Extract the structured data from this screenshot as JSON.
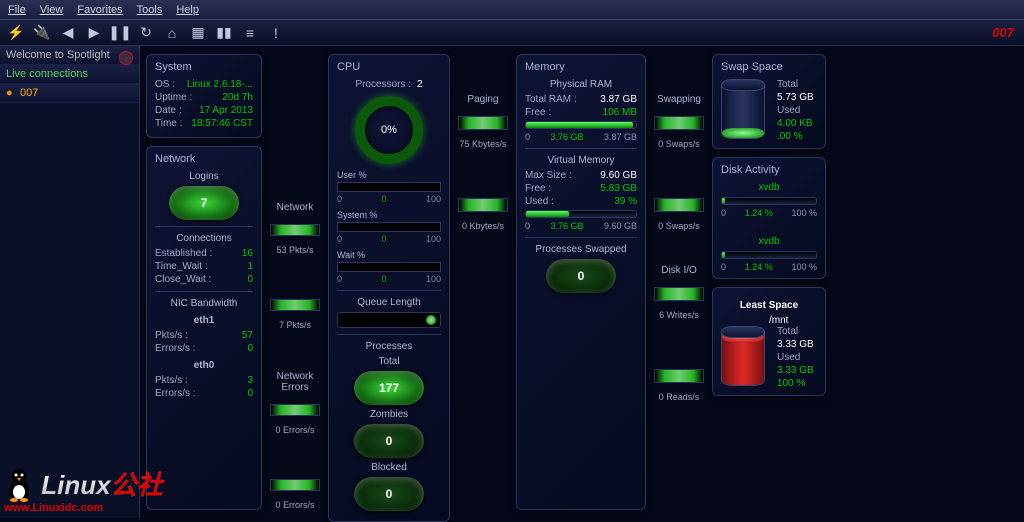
{
  "menu": {
    "file": "File",
    "view": "View",
    "favorites": "Favorites",
    "tools": "Tools",
    "help": "Help"
  },
  "host_id": "007",
  "sidebar": {
    "welcome": "Welcome to Spotlight",
    "live": "Live connections",
    "host": "007"
  },
  "system": {
    "title": "System",
    "os_k": "OS :",
    "os_v": "Linux  2.6.18-...",
    "up_k": "Uptime :",
    "up_v": "20d 7h",
    "date_k": "Date :",
    "date_v": "17 Apr 2013",
    "time_k": "Time :",
    "time_v": "18:57:46 CST"
  },
  "network": {
    "title": "Network",
    "logins_label": "Logins",
    "logins": "7",
    "conns_label": "Connections",
    "est_k": "Established :",
    "est_v": "16",
    "tw_k": "Time_Wait :",
    "tw_v": "1",
    "cw_k": "Close_Wait :",
    "cw_v": "0",
    "nicbw": "NIC Bandwidth",
    "nic1": "eth1",
    "nic1_pk": "Pkts/s :",
    "nic1_pv": "57",
    "nic1_ek": "Errors/s :",
    "nic1_ev": "0",
    "nic0": "eth0",
    "nic0_pk": "Pkts/s :",
    "nic0_pv": "3",
    "nic0_ek": "Errors/s :",
    "nic0_ev": "0"
  },
  "netflow": {
    "label": "Network",
    "v1": "53 Pkts/s",
    "v2": "7 Pkts/s",
    "errlabel": "Network Errors",
    "e1": "0 Errors/s",
    "e2": "0 Errors/s"
  },
  "cpu": {
    "title": "CPU",
    "proc_k": "Processors :",
    "proc_v": "2",
    "pct": "0%",
    "user": "User %",
    "system": "System %",
    "wait": "Wait %",
    "s0": "0",
    "sg": "0",
    "s100": "100",
    "qlen": "Queue Length",
    "processes": "Processes",
    "total_l": "Total",
    "total": "177",
    "zombies_l": "Zombies",
    "zombies": "0",
    "blocked_l": "Blocked",
    "blocked": "0"
  },
  "paging": {
    "label": "Paging",
    "v1": "75 Kbytes/s",
    "v2": "0 Kbytes/s"
  },
  "memory": {
    "title": "Memory",
    "phys": "Physical RAM",
    "tram_k": "Total RAM :",
    "tram_v": "3.87 GB",
    "free_k": "Free :",
    "free_v": "106 MB",
    "bar_lo": "0",
    "bar_mid": "3.76 GB",
    "bar_hi": "3.87 GB",
    "virt": "Virtual Memory",
    "max_k": "Max Size :",
    "max_v": "9.60 GB",
    "vfree_k": "Free :",
    "vfree_v": "5.83 GB",
    "used_k": "Used :",
    "used_v": "39 %",
    "vbar_lo": "0",
    "vbar_mid": "3.76 GB",
    "vbar_hi": "9.60 GB",
    "pswap_l": "Processes Swapped",
    "pswap": "0"
  },
  "swapping": {
    "label": "Swapping",
    "v1": "0 Swaps/s",
    "v2": "0 Swaps/s",
    "io_label": "Disk I/O",
    "io1": "6 Writes/s",
    "io2": "0 Reads/s"
  },
  "swap": {
    "title": "Swap Space",
    "total_l": "Total",
    "total": "5.73 GB",
    "used_l": "Used",
    "used": "4.00 KB",
    "pct": ".00 %"
  },
  "disk": {
    "title": "Disk Activity",
    "d1": "xvdb",
    "d1_lo": "0",
    "d1_mid": "1.24 %",
    "d1_hi": "100 %",
    "d2": "xvdb",
    "d2_lo": "0",
    "d2_mid": "1.24 %",
    "d2_hi": "100 %"
  },
  "least": {
    "title": "Least Space",
    "mount": "/mnt",
    "total_l": "Total",
    "total": "3.33 GB",
    "used_l": "Used",
    "used": "3.33 GB",
    "pct": "100 %"
  },
  "watermark": {
    "brand": "Linux",
    "suffix": "公社",
    "url": "www.Linuxidc.com"
  }
}
